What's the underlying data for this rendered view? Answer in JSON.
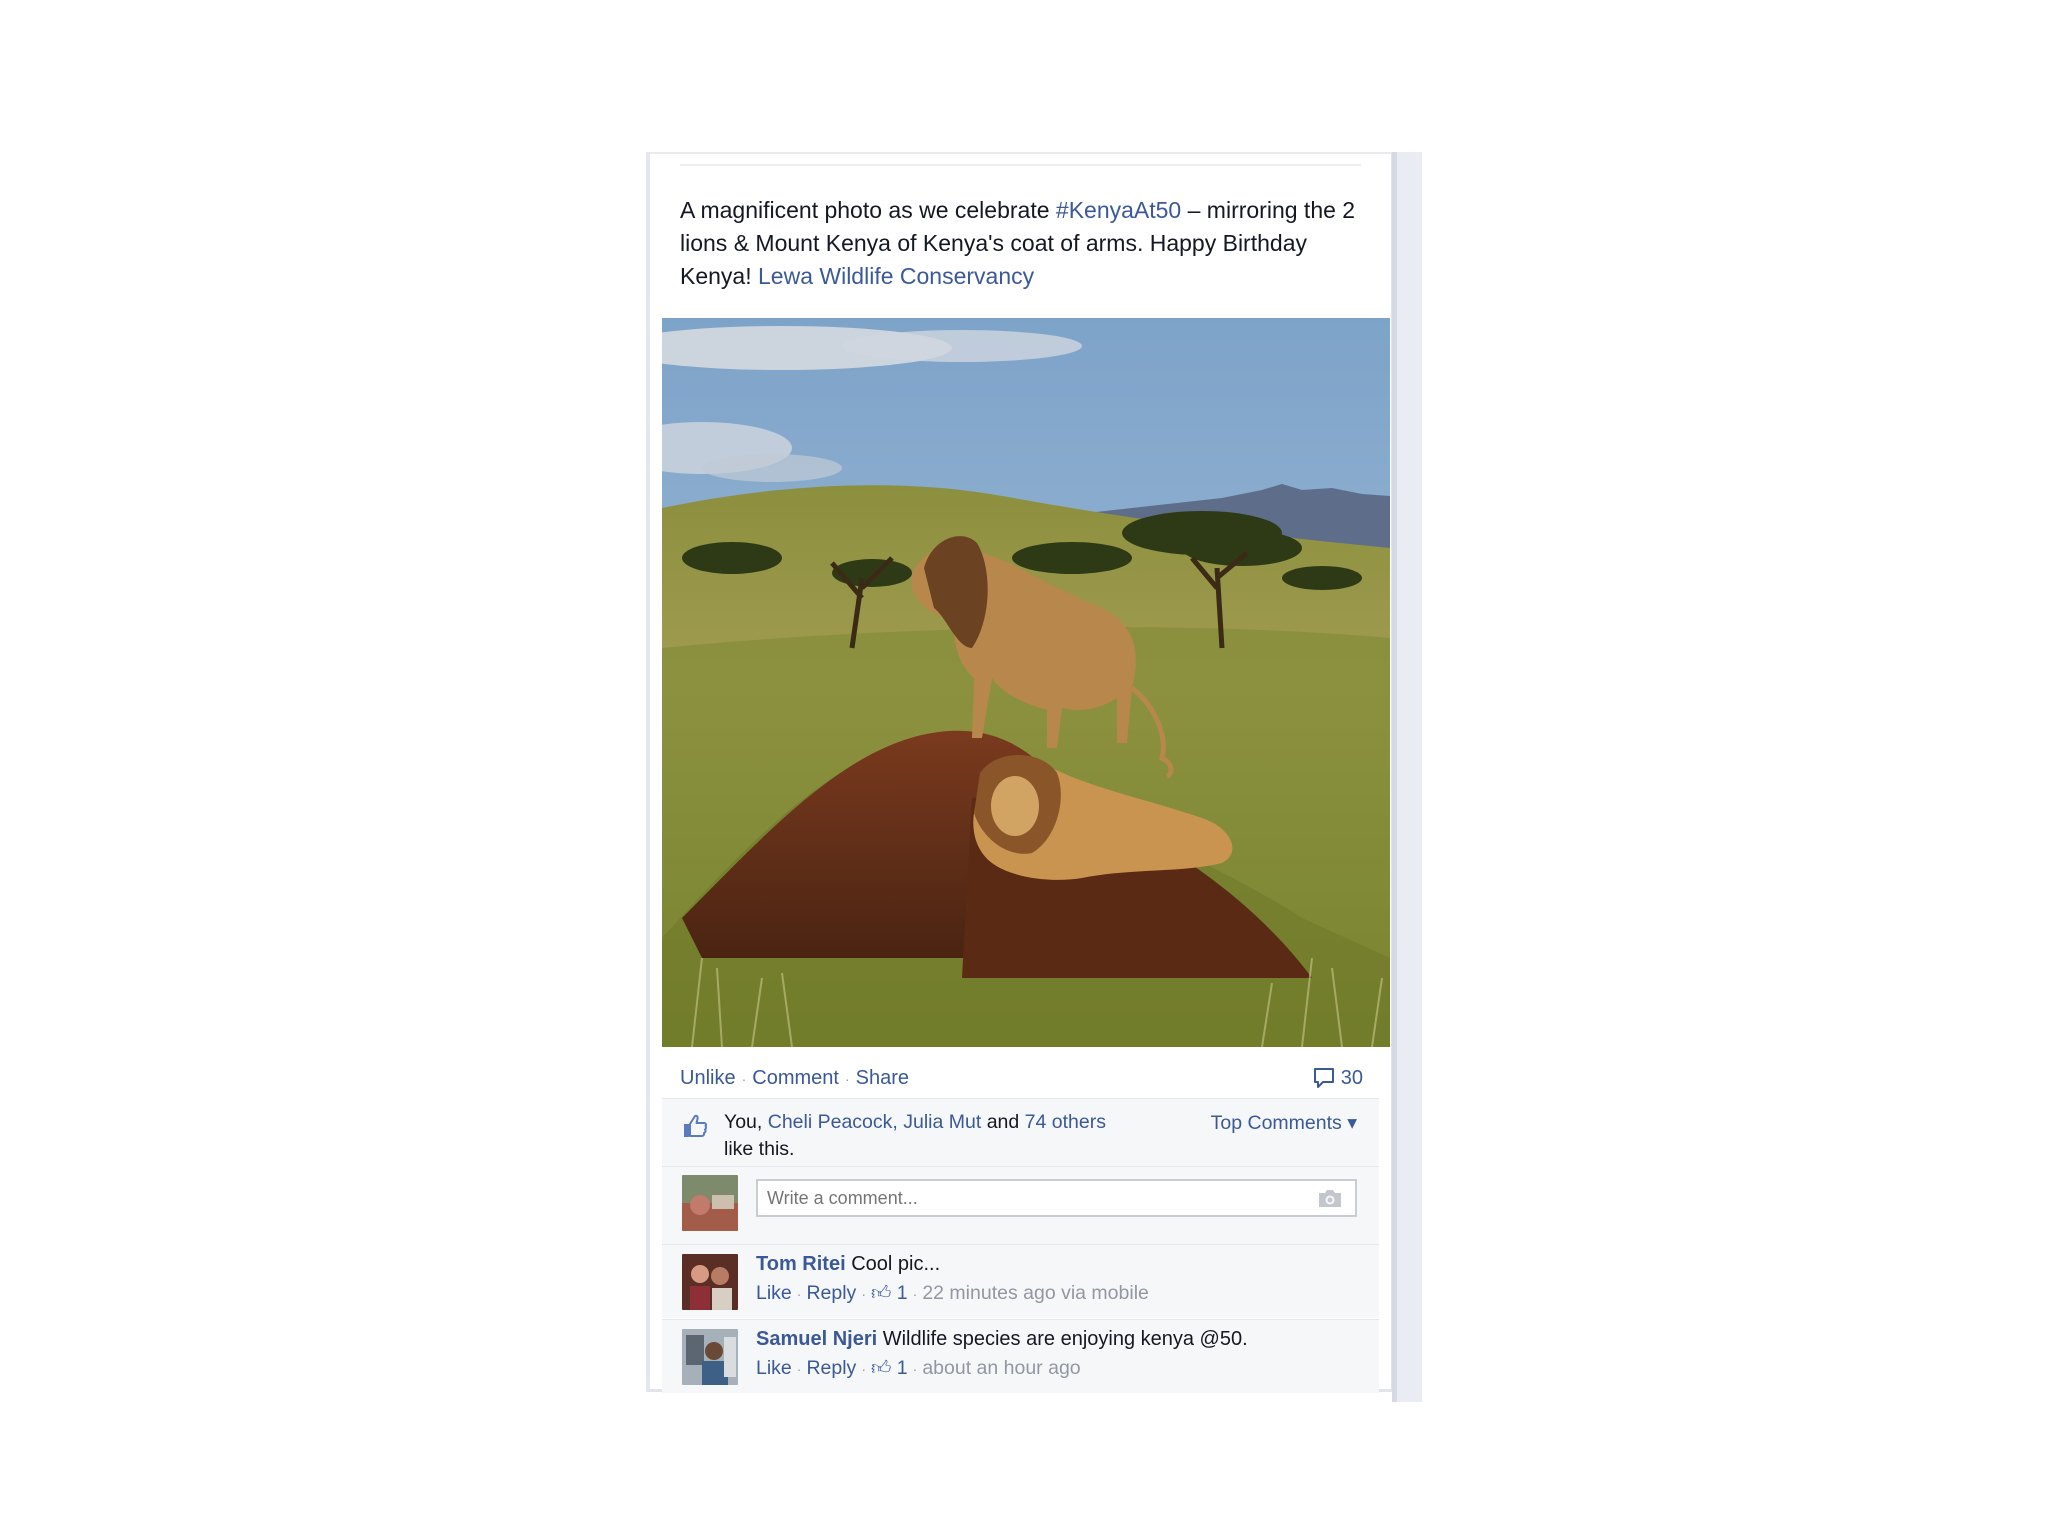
{
  "post": {
    "text_before": "A magnificent photo as we celebrate ",
    "hashtag": "#KenyaAt50",
    "text_middle": " – mirroring the 2 lions & Mount Kenya of Kenya's coat of arms. Happy Birthday Kenya! ",
    "page_link": "Lewa Wildlife Conservancy"
  },
  "actions": {
    "unlike": "Unlike",
    "comment": "Comment",
    "share": "Share",
    "comment_count": "30"
  },
  "likes": {
    "you": "You,",
    "friend1": "Cheli Peacock,",
    "friend2": "Julia Mut",
    "and": "and",
    "others": "74 others",
    "suffix": "like this.",
    "top_comments": "Top Comments"
  },
  "comment_box": {
    "placeholder": "Write a comment..."
  },
  "comments": [
    {
      "author": "Tom Ritei",
      "text": "Cool pic...",
      "like": "Like",
      "reply": "Reply",
      "likes": "1",
      "time": "22 minutes ago via mobile"
    },
    {
      "author": "Samuel Njeri",
      "text": "Wildlife species are enjoying kenya @50.",
      "like": "Like",
      "reply": "Reply",
      "likes": "1",
      "time": "about an hour ago"
    }
  ],
  "colors": {
    "link": "#3b5998",
    "muted": "#9197a3",
    "ufi_background": "#f6f7f9"
  },
  "icons": [
    "thumbs-up-icon",
    "comment-bubble-icon",
    "camera-icon",
    "small-like-icon"
  ]
}
